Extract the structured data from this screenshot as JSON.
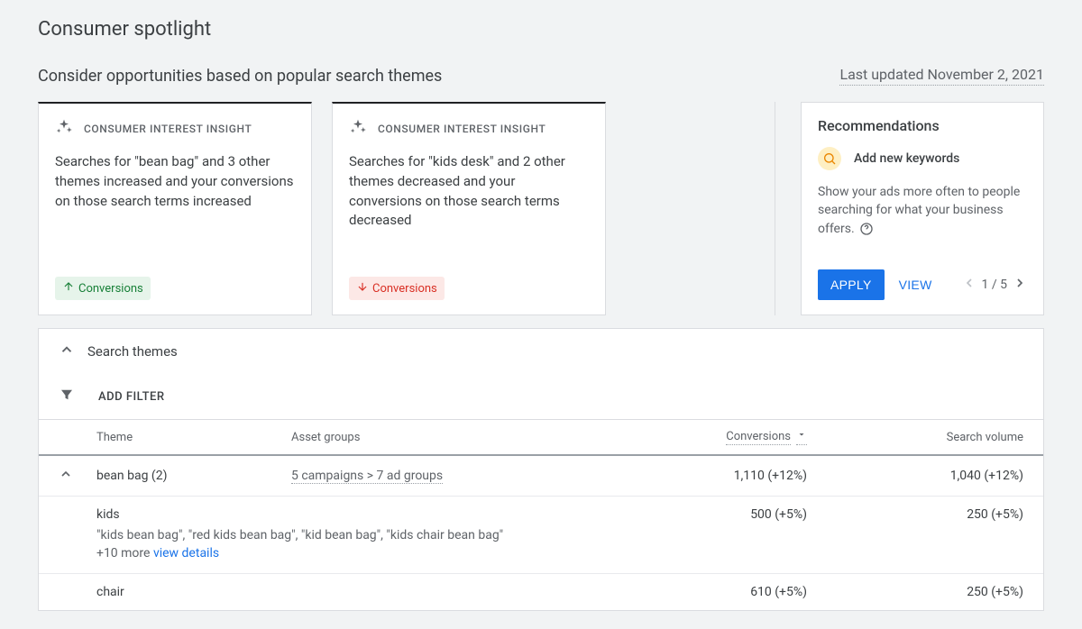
{
  "page_title": "Consumer spotlight",
  "section_title": "Consider opportunities based on popular search themes",
  "last_updated": "Last updated November 2, 2021",
  "insight_kicker": "CONSUMER INTEREST INSIGHT",
  "insights": [
    {
      "body": "Searches for \"bean bag\" and 3 other themes increased and your conversions on those search terms increased",
      "direction": "up",
      "badge_label": "Conversions"
    },
    {
      "body": "Searches for \"kids desk\" and 2 other themes decreased and your conversions on those search terms decreased",
      "direction": "down",
      "badge_label": "Conversions"
    }
  ],
  "recommendations": {
    "title": "Recommendations",
    "item_name": "Add new keywords",
    "body": "Show your ads more often to people searching for what your business offers.",
    "apply_label": "APPLY",
    "view_label": "VIEW",
    "pager": "1 / 5"
  },
  "themes": {
    "panel_title": "Search themes",
    "add_filter_label": "ADD FILTER",
    "columns": {
      "theme": "Theme",
      "asset": "Asset groups",
      "conversions": "Conversions",
      "volume": "Search volume"
    },
    "row1": {
      "theme": "bean bag (2)",
      "asset": "5 campaigns > 7 ad groups",
      "conversions": "1,110 (+12%)",
      "volume": "1,040 (+12%)"
    },
    "sub1": {
      "theme": "kids",
      "conversions": "500 (+5%)",
      "volume": "250 (+5%)",
      "terms": "\"kids bean bag\", \"red kids bean bag\", \"kid bean bag\", \"kids chair bean bag\"",
      "more": "+10 more",
      "view_details": "view details"
    },
    "sub2": {
      "theme": "chair",
      "conversions": "610 (+5%)",
      "volume": "250 (+5%)"
    }
  }
}
